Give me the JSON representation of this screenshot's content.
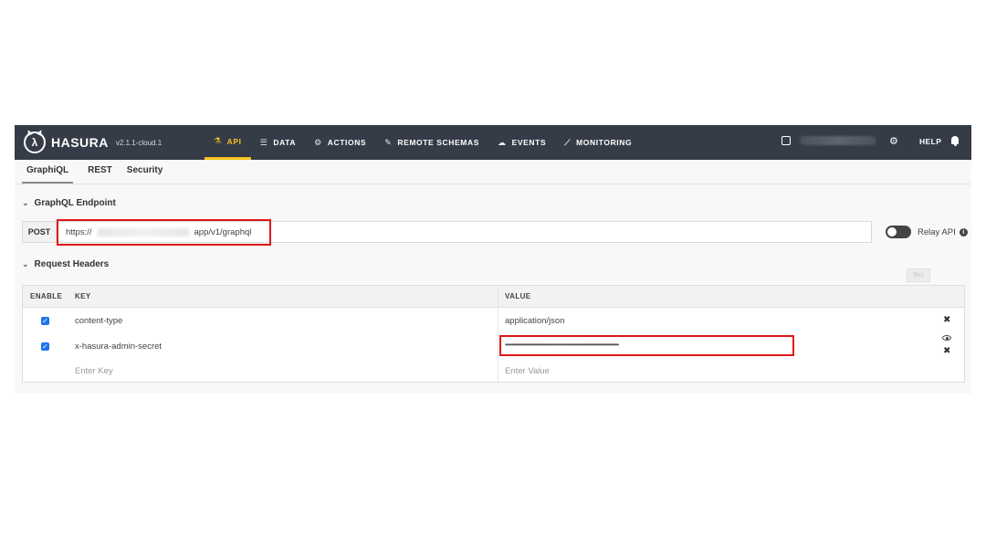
{
  "app": {
    "brand": "HASURA",
    "version": "v2.1.1-cloud.1",
    "nav": [
      {
        "label": "API",
        "icon": "flask-icon",
        "glyph": "⚗",
        "active": true
      },
      {
        "label": "DATA",
        "icon": "database-icon",
        "glyph": "☰",
        "active": false
      },
      {
        "label": "ACTIONS",
        "icon": "cogs-icon",
        "glyph": "⚙",
        "active": false
      },
      {
        "label": "REMOTE SCHEMAS",
        "icon": "plug-icon",
        "glyph": "✎",
        "active": false
      },
      {
        "label": "EVENTS",
        "icon": "cloud-icon",
        "glyph": "☁",
        "active": false
      },
      {
        "label": "MONITORING",
        "icon": "chart-line-icon",
        "glyph": "📈",
        "active": false
      }
    ],
    "help_label": "HELP"
  },
  "subtabs": [
    {
      "label": "GraphiQL",
      "active": true
    },
    {
      "label": "REST",
      "active": false
    },
    {
      "label": "Security",
      "active": false
    }
  ],
  "endpoint": {
    "section_title": "GraphQL Endpoint",
    "method": "POST",
    "url_prefix": "https://",
    "url_suffix": "app/v1/graphql",
    "relay_label": "Relay API",
    "relay_enabled": false
  },
  "headers": {
    "section_title": "Request Headers",
    "bulk_label": "Bkz",
    "columns": {
      "enable": "ENABLE",
      "key": "KEY",
      "value": "VALUE"
    },
    "rows": [
      {
        "enabled": true,
        "key": "content-type",
        "value": "application/json"
      },
      {
        "enabled": true,
        "key": "x-hasura-admin-secret",
        "value": "•••••••••••••••••••••••••••••••••••••••••••••••••••••••••••••••••••••"
      }
    ],
    "new_key_placeholder": "Enter Key",
    "new_value_placeholder": "Enter Value"
  },
  "colors": {
    "topbar": "#353c47",
    "accent": "#f8c21f",
    "highlight": "#e01818",
    "checkbox": "#1e73e8"
  }
}
